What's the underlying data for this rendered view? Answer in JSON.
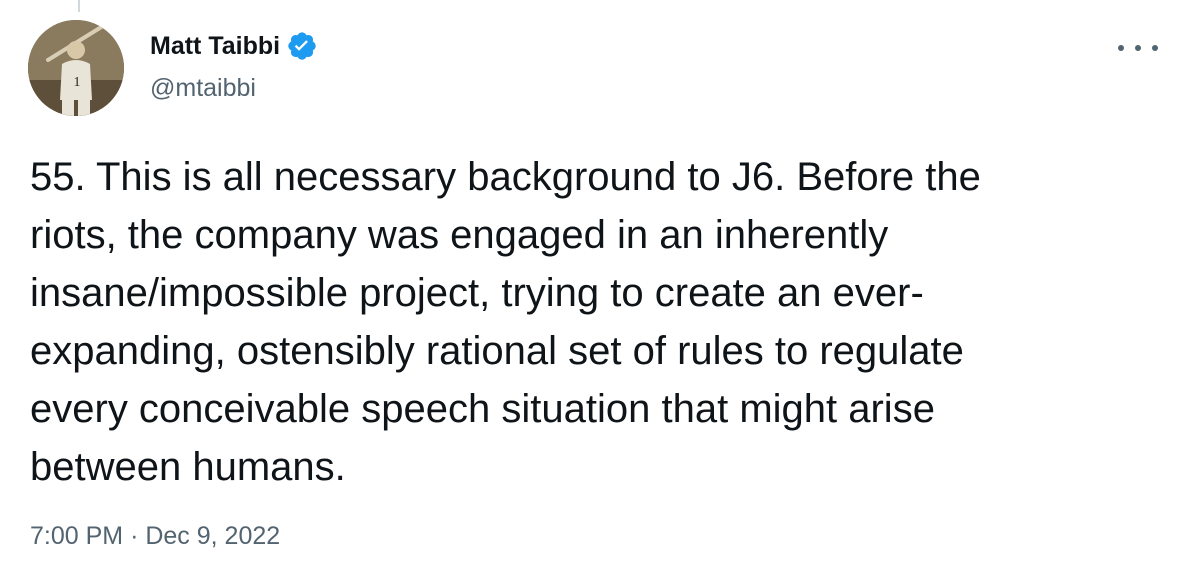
{
  "tweet": {
    "author": {
      "display_name": "Matt Taibbi",
      "handle": "@mtaibbi",
      "verified": true,
      "avatar_icon": "author-avatar"
    },
    "more_icon": "more-options-icon",
    "text_lines": [
      "55. This is all necessary background to J6. Before the",
      "riots, the company was engaged in an inherently",
      "insane/impossible project, trying to create an ever-",
      "expanding, ostensibly rational set of rules to regulate",
      "every conceivable speech situation that might arise",
      "between humans."
    ],
    "time": "7:00 PM",
    "separator": "·",
    "date": "Dec 9, 2022"
  },
  "colors": {
    "primary_text": "#0f1419",
    "secondary_text": "#536471",
    "verified_blue": "#1d9bf0",
    "background": "#ffffff"
  }
}
